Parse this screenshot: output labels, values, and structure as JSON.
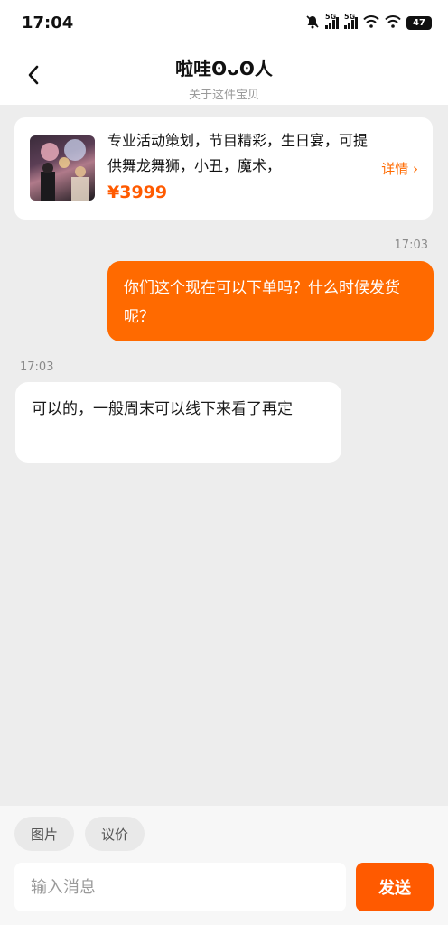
{
  "status_bar": {
    "time": "17:04",
    "network_1": "5G",
    "network_2": "5G",
    "battery": "47",
    "icons": [
      "mute-bell-icon",
      "signal-icon",
      "signal-icon",
      "wifi-icon",
      "wifi-icon",
      "battery-icon"
    ]
  },
  "header": {
    "title": "啦哇ʘᴗʘ人",
    "subtitle": "关于这件宝贝",
    "back_icon": "chevron-left-icon"
  },
  "product": {
    "description": "专业活动策划，节目精彩，生日宴，可提供舞龙舞狮，小丑，魔术，",
    "price": "¥3999",
    "detail_link": "详情 ›"
  },
  "messages": [
    {
      "direction": "out",
      "time": "17:03",
      "text": "你们这个现在可以下单吗？什么时候发货呢？"
    },
    {
      "direction": "in",
      "time": "17:03",
      "text": "可以的，一般周末可以线下来看了再定"
    }
  ],
  "bottom": {
    "quick_actions": [
      "图片",
      "议价"
    ],
    "input_placeholder": "输入消息",
    "send_label": "发送"
  },
  "colors": {
    "accent": "#ff6a00",
    "price": "#ff5a00",
    "background": "#ededed"
  }
}
